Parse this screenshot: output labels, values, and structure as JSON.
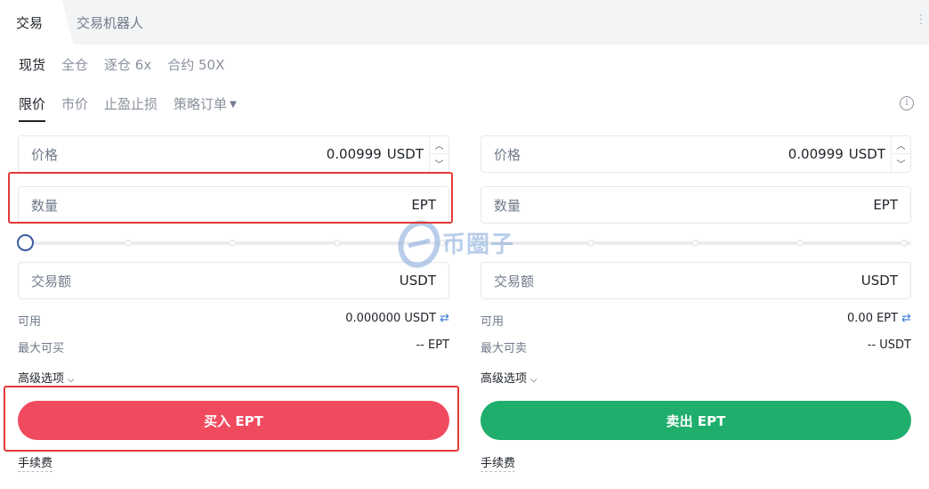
{
  "tabs": {
    "active": "交易",
    "inactive": "交易机器人"
  },
  "modes": [
    "现货",
    "全仓",
    "逐仓 6x",
    "合约 50X"
  ],
  "order_types": [
    "限价",
    "市价",
    "止盈止损",
    "策略订单"
  ],
  "buy": {
    "price_label": "价格",
    "price_value": "0.00999",
    "price_unit": "USDT",
    "qty_label": "数量",
    "qty_unit": "EPT",
    "amount_label": "交易额",
    "amount_unit": "USDT",
    "avail_label": "可用",
    "avail_value": "0.000000 USDT",
    "max_label": "最大可买",
    "max_value": "-- EPT",
    "advanced": "高级选项",
    "button": "买入 EPT",
    "fee": "手续费"
  },
  "sell": {
    "price_label": "价格",
    "price_value": "0.00999",
    "price_unit": "USDT",
    "qty_label": "数量",
    "qty_unit": "EPT",
    "amount_label": "交易额",
    "amount_unit": "USDT",
    "avail_label": "可用",
    "avail_value": "0.00 EPT",
    "max_label": "最大可卖",
    "max_value": "-- USDT",
    "advanced": "高级选项",
    "button": "卖出 EPT",
    "fee": "手续费"
  },
  "slider_percent": 0,
  "watermark": "币圈子",
  "colors": {
    "buy": "#f04a5f",
    "sell": "#1fae6c",
    "highlight": "#e53935"
  },
  "icons": [
    "stepper-up-icon",
    "stepper-down-icon",
    "swap-icon",
    "chevron-down-icon",
    "info-icon"
  ]
}
